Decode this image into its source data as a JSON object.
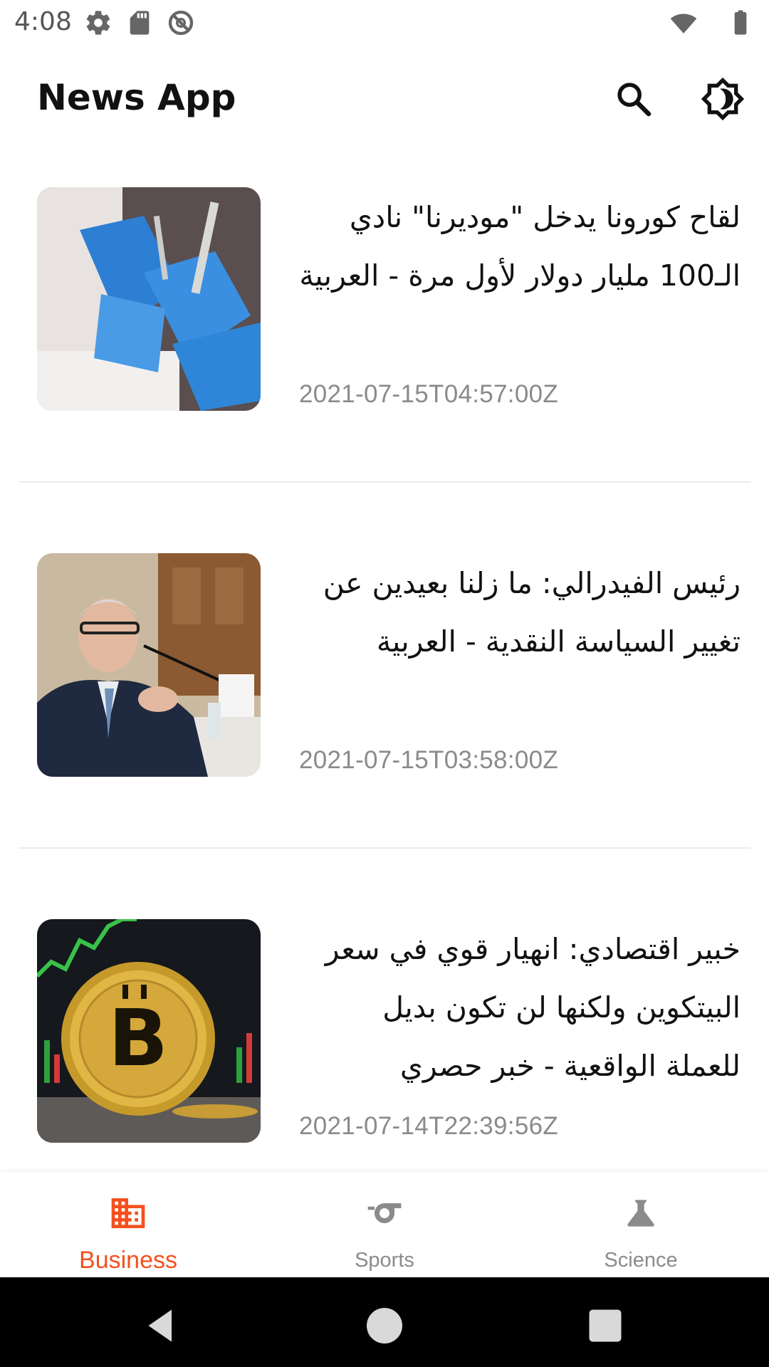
{
  "status_bar": {
    "time": "4:08",
    "icons_left": [
      "settings-icon",
      "sd-card-icon",
      "do-not-disturb-icon"
    ],
    "icons_right": [
      "wifi-icon",
      "battery-icon"
    ]
  },
  "app_bar": {
    "title": "News App",
    "actions": [
      "search-icon",
      "brightness-icon"
    ]
  },
  "articles": [
    {
      "title": "لقاح كورونا يدخل \"موديرنا\" نادي الـ100 مليار دولار لأول مرة - العربية",
      "published_at": "2021-07-15T04:57:00Z",
      "image": "vaccine-photo"
    },
    {
      "title": "رئيس الفيدرالي: ما زلنا بعيدين عن تغيير السياسة النقدية - العربية",
      "published_at": "2021-07-15T03:58:00Z",
      "image": "fed-chair-photo"
    },
    {
      "title": "خبير اقتصادي: انهيار قوي في سعر البيتكوين ولكنها لن تكون بديل للعملة الواقعية - خبر حصري",
      "published_at": "2021-07-14T22:39:56Z",
      "image": "bitcoin-photo"
    }
  ],
  "bottom_nav": {
    "items": [
      {
        "label": "Business",
        "icon": "business-icon",
        "active": true
      },
      {
        "label": "Sports",
        "icon": "whistle-icon",
        "active": false
      },
      {
        "label": "Science",
        "icon": "flask-icon",
        "active": false
      }
    ],
    "active_color": "#f4511e",
    "inactive_color": "#8b8b8b"
  },
  "system_nav": [
    "back-icon",
    "home-icon",
    "recents-icon"
  ]
}
